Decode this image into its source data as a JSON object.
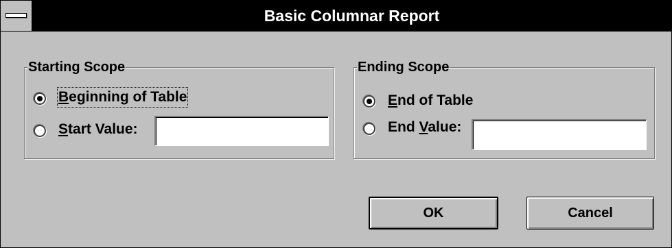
{
  "window": {
    "title": "Basic Columnar Report"
  },
  "starting_scope": {
    "label": "Starting Scope",
    "options": [
      {
        "pre": "",
        "mnemonic": "B",
        "post": "eginning of Table",
        "checked": true
      },
      {
        "pre": "",
        "mnemonic": "S",
        "post": "tart Value:",
        "checked": false
      }
    ],
    "start_value": ""
  },
  "ending_scope": {
    "label": "Ending Scope",
    "options": [
      {
        "pre": "",
        "mnemonic": "E",
        "post": "nd of Table",
        "checked": true
      },
      {
        "pre": "End ",
        "mnemonic": "V",
        "post": "alue:",
        "checked": false
      }
    ],
    "end_value": ""
  },
  "buttons": {
    "ok": "OK",
    "cancel": "Cancel"
  }
}
